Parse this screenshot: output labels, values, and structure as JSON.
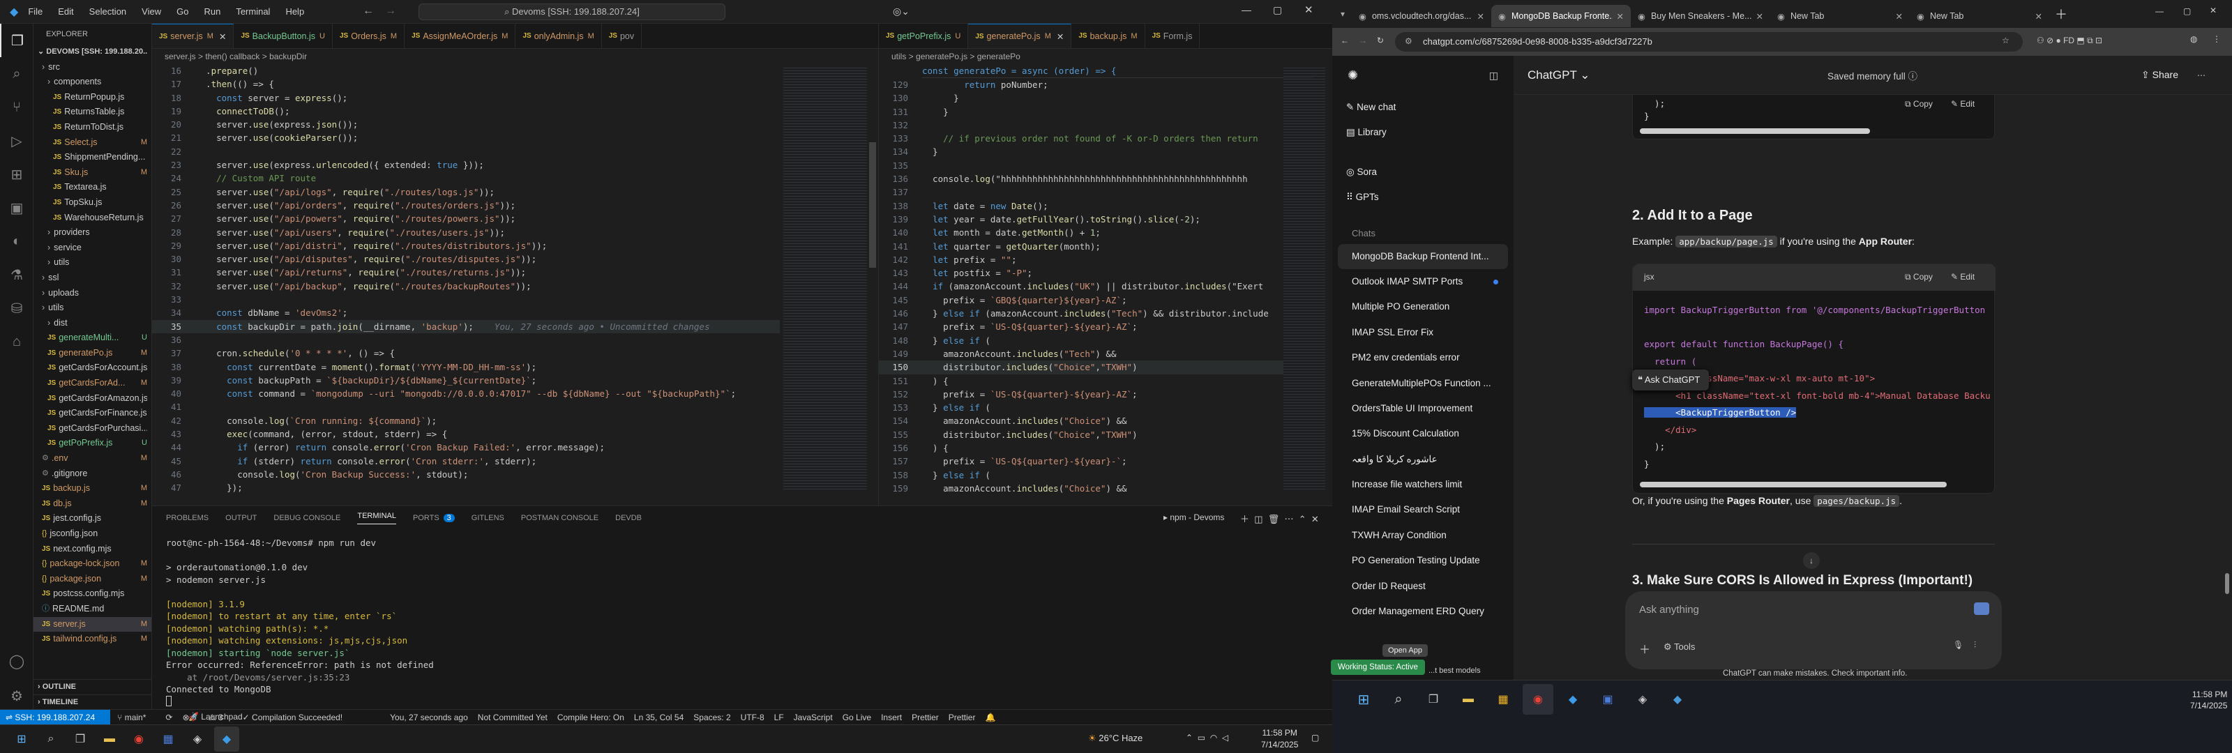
{
  "vscode": {
    "menu": [
      "File",
      "Edit",
      "Selection",
      "View",
      "Go",
      "Run",
      "Terminal",
      "Help"
    ],
    "search": "Devoms [SSH: 199.188.207.24]",
    "explorer": {
      "header": "EXPLORER",
      "root": "DEVOMS [SSH: 199.188.20...",
      "items": [
        {
          "label": "src",
          "kind": "folder",
          "indent": 1
        },
        {
          "label": "components",
          "kind": "folder",
          "indent": 2
        },
        {
          "label": "ReturnPopup.js",
          "kind": "js",
          "indent": 3,
          "status": ""
        },
        {
          "label": "ReturnsTable.js",
          "kind": "js",
          "indent": 3,
          "status": ""
        },
        {
          "label": "ReturnToDist.js",
          "kind": "js",
          "indent": 3,
          "status": ""
        },
        {
          "label": "Select.js",
          "kind": "js",
          "indent": 3,
          "status": "M"
        },
        {
          "label": "ShippmentPending...",
          "kind": "js",
          "indent": 3,
          "status": ""
        },
        {
          "label": "Sku.js",
          "kind": "js",
          "indent": 3,
          "status": "M"
        },
        {
          "label": "Textarea.js",
          "kind": "js",
          "indent": 3,
          "status": ""
        },
        {
          "label": "TopSku.js",
          "kind": "js",
          "indent": 3,
          "status": ""
        },
        {
          "label": "WarehouseReturn.js",
          "kind": "js",
          "indent": 3,
          "status": ""
        },
        {
          "label": "providers",
          "kind": "folder",
          "indent": 2
        },
        {
          "label": "service",
          "kind": "folder",
          "indent": 2
        },
        {
          "label": "utils",
          "kind": "folder",
          "indent": 2
        },
        {
          "label": "ssl",
          "kind": "folder",
          "indent": 1
        },
        {
          "label": "uploads",
          "kind": "folder",
          "indent": 1
        },
        {
          "label": "utils",
          "kind": "folder",
          "indent": 1
        },
        {
          "label": "dist",
          "kind": "folder",
          "indent": 2
        },
        {
          "label": "generateMulti...",
          "kind": "js",
          "indent": 2,
          "status": "U"
        },
        {
          "label": "generatePo.js",
          "kind": "js",
          "indent": 2,
          "status": "M"
        },
        {
          "label": "getCardsForAccount.js",
          "kind": "js",
          "indent": 2,
          "status": ""
        },
        {
          "label": "getCardsForAd...",
          "kind": "js",
          "indent": 2,
          "status": "M"
        },
        {
          "label": "getCardsForAmazon.js",
          "kind": "js",
          "indent": 2,
          "status": ""
        },
        {
          "label": "getCardsForFinance.js",
          "kind": "js",
          "indent": 2,
          "status": ""
        },
        {
          "label": "getCardsForPurchasi...",
          "kind": "js",
          "indent": 2,
          "status": ""
        },
        {
          "label": "getPoPrefix.js",
          "kind": "js",
          "indent": 2,
          "status": "U"
        },
        {
          "label": ".env",
          "kind": "file",
          "indent": 1,
          "status": "M"
        },
        {
          "label": ".gitignore",
          "kind": "file",
          "indent": 1,
          "status": ""
        },
        {
          "label": "backup.js",
          "kind": "js",
          "indent": 1,
          "status": "M"
        },
        {
          "label": "db.js",
          "kind": "js",
          "indent": 1,
          "status": "M"
        },
        {
          "label": "jest.config.js",
          "kind": "js",
          "indent": 1,
          "status": ""
        },
        {
          "label": "jsconfig.json",
          "kind": "json",
          "indent": 1,
          "status": ""
        },
        {
          "label": "next.config.mjs",
          "kind": "js",
          "indent": 1,
          "status": ""
        },
        {
          "label": "package-lock.json",
          "kind": "json",
          "indent": 1,
          "status": "M"
        },
        {
          "label": "package.json",
          "kind": "json",
          "indent": 1,
          "status": "M"
        },
        {
          "label": "postcss.config.mjs",
          "kind": "js",
          "indent": 1,
          "status": ""
        },
        {
          "label": "README.md",
          "kind": "md",
          "indent": 1,
          "status": ""
        },
        {
          "label": "server.js",
          "kind": "js",
          "indent": 1,
          "status": "M",
          "selected": true
        },
        {
          "label": "tailwind.config.js",
          "kind": "js",
          "indent": 1,
          "status": "M"
        }
      ],
      "outline": "OUTLINE",
      "timeline": "TIMELINE"
    },
    "left_tabs": [
      {
        "label": "server.js",
        "status": "M",
        "active": true
      },
      {
        "label": "BackupButton.js",
        "status": "U"
      },
      {
        "label": "Orders.js",
        "status": "M"
      },
      {
        "label": "AssignMeAOrder.js",
        "status": "M"
      },
      {
        "label": "onlyAdmin.js",
        "status": "M"
      },
      {
        "label": "pov",
        "status": ""
      }
    ],
    "left_breadcrumb": "server.js > then() callback > backupDir",
    "left_start_line": 16,
    "left_current_line": 35,
    "left_code": [
      "  .prepare()",
      "  .then(() => {",
      "    const server = express();",
      "    connectToDB();",
      "    server.use(express.json());",
      "    server.use(cookieParser());",
      "",
      "    server.use(express.urlencoded({ extended: true }));",
      "    // Custom API route",
      "    server.use(\"/api/logs\", require(\"./routes/logs.js\"));",
      "    server.use(\"/api/orders\", require(\"./routes/orders.js\"));",
      "    server.use(\"/api/powers\", require(\"./routes/powers.js\"));",
      "    server.use(\"/api/users\", require(\"./routes/users.js\"));",
      "    server.use(\"/api/distri\", require(\"./routes/distributors.js\"));",
      "    server.use(\"/api/disputes\", require(\"./routes/disputes.js\"));",
      "    server.use(\"/api/returns\", require(\"./routes/returns.js\"));",
      "    server.use(\"/api/backup\", require(\"./routes/backupRoutes\"));",
      "",
      "    const dbName = 'devOms2';",
      "    const backupDir = path.join(__dirname, 'backup');",
      "",
      "    cron.schedule('0 * * * *', () => {",
      "      const currentDate = moment().format('YYYY-MM-DD_HH-mm-ss');",
      "      const backupPath = `${backupDir}/${dbName}_${currentDate}`;",
      "      const command = `mongodump --uri \"mongodb://0.0.0.0:47017\" --db ${dbName} --out \"${backupPath}\"`;",
      "",
      "      console.log(`Cron running: ${command}`);",
      "      exec(command, (error, stdout, stderr) => {",
      "        if (error) return console.error('Cron Backup Failed:', error.message);",
      "        if (stderr) return console.error('Cron stderr:', stderr);",
      "        console.log('Cron Backup Success:', stdout);",
      "      });",
      "    });"
    ],
    "blame": "You, 27 seconds ago • Uncommitted changes",
    "right_tabs": [
      {
        "label": "getPoPrefix.js",
        "status": "U"
      },
      {
        "label": "generatePo.js",
        "status": "M",
        "active": true
      },
      {
        "label": "backup.js",
        "status": "M"
      },
      {
        "label": "Form.js",
        "status": ""
      }
    ],
    "right_breadcrumb": "utils > generatePo.js > generatePo",
    "right_header": "const generatePo = async (order) => {",
    "right_start_line": 129,
    "right_current_line": 150,
    "right_code": [
      "        return poNumber;",
      "      }",
      "    }",
      "",
      "    // if previous order not found of -K or-D orders then return",
      "  }",
      "",
      "  console.log(\"hhhhhhhhhhhhhhhhhhhhhhhhhhhhhhhhhhhhhhhhhhhhhhh",
      "",
      "  let date = new Date();",
      "  let year = date.getFullYear().toString().slice(-2);",
      "  let month = date.getMonth() + 1;",
      "  let quarter = getQuarter(month);",
      "  let prefix = \"\";",
      "  let postfix = \"-P\";",
      "  if (amazonAccount.includes(\"UK\") || distributor.includes(\"Exert",
      "    prefix = `GBQ${quarter}${year}-AZ`;",
      "  } else if (amazonAccount.includes(\"Tech\") && distributor.include",
      "    prefix = `US-Q${quarter}-${year}-AZ`;",
      "  } else if (",
      "    amazonAccount.includes(\"Tech\") &&",
      "    distributor.includes(\"Choice\",\"TXWH\")",
      "  ) {",
      "    prefix = `US-Q${quarter}-${year}-AZ`;",
      "  } else if (",
      "    amazonAccount.includes(\"Choice\") &&",
      "    distributor.includes(\"Choice\",\"TXWH\")",
      "  ) {",
      "    prefix = `US-Q${quarter}-${year}-`;",
      "  } else if (",
      "    amazonAccount.includes(\"Choice\") &&",
      "    distributor.includes(\"Tech\",\"TXWH\")"
    ],
    "panel_tabs": [
      "PROBLEMS",
      "OUTPUT",
      "DEBUG CONSOLE",
      "TERMINAL",
      "PORTS",
      "GITLENS",
      "POSTMAN CONSOLE",
      "DEVDB"
    ],
    "ports_badge": "3",
    "terminal_title": "npm - Devoms",
    "terminal_lines": [
      {
        "t": "root@nc-ph-1564-48:~/Devoms# npm run dev",
        "c": "#ccc"
      },
      {
        "t": "",
        "c": "#ccc"
      },
      {
        "t": "> orderautomation@0.1.0 dev",
        "c": "#ccc"
      },
      {
        "t": "> nodemon server.js",
        "c": "#ccc"
      },
      {
        "t": "",
        "c": "#ccc"
      },
      {
        "t": "[nodemon] 3.1.9",
        "c": "#d7ba3d"
      },
      {
        "t": "[nodemon] to restart at any time, enter `rs`",
        "c": "#d7ba3d"
      },
      {
        "t": "[nodemon] watching path(s): *.*",
        "c": "#d7ba3d"
      },
      {
        "t": "[nodemon] watching extensions: js,mjs,cjs,json",
        "c": "#d7ba3d"
      },
      {
        "t": "[nodemon] starting `node server.js`",
        "c": "#73c991"
      },
      {
        "t": "Error occurred: ReferenceError: path is not defined",
        "c": "#ccc"
      },
      {
        "t": "    at /root/Devoms/server.js:35:23",
        "c": "#999"
      },
      {
        "t": "Connected to MongoDB",
        "c": "#ccc"
      }
    ],
    "status": {
      "remote": "SSH: 199.188.207.24",
      "branch": "main*",
      "errors": "0",
      "warnings": "3",
      "compile": "Compilation Succeeded!",
      "blame": "You, 27 seconds ago",
      "commit": "Not Committed Yet",
      "hero": "Compile Hero: On",
      "pos": "Ln 35, Col 54",
      "spaces": "Spaces: 2",
      "enc": "UTF-8",
      "eol": "LF",
      "lang": "JavaScript",
      "golive": "Go Live",
      "insert": "Insert",
      "prettier": "Prettier",
      "prettier2": "Prettier"
    }
  },
  "taskbar": {
    "weather": "26°C  Haze",
    "time": "11:58 PM",
    "date": "7/14/2025",
    "launchpad": "Launchpad"
  },
  "chrome": {
    "tabs": [
      {
        "label": "oms.vcloudtech.org/das...",
        "active": false
      },
      {
        "label": "MongoDB Backup Fronte...",
        "active": true
      },
      {
        "label": "Buy Men Sneakers - Me...",
        "active": false
      },
      {
        "label": "New Tab",
        "active": false
      },
      {
        "label": "New Tab",
        "active": false
      }
    ],
    "url": "chatgpt.com/c/6875269d-0e98-8008-b335-a9dcf3d7227b"
  },
  "chatgpt": {
    "new_chat": "New chat",
    "library": "Library",
    "sora": "Sora",
    "gpts": "GPTs",
    "chats_label": "Chats",
    "chats": [
      "MongoDB Backup Frontend Int...",
      "Outlook IMAP SMTP Ports",
      "Multiple PO Generation",
      "IMAP SSL Error Fix",
      "PM2 env credentials error",
      "GenerateMultiplePOs Function ...",
      "OrdersTable UI Improvement",
      "15% Discount Calculation",
      "عاشوره کربلا کا واقعہ",
      "Increase file watchers limit",
      "IMAP Email Search Script",
      "TXWH Array Condition",
      "PO Generation Testing Update",
      "Order ID Request",
      "Order Management ERD Query"
    ],
    "model": "ChatGPT",
    "memory": "Saved memory full",
    "share": "Share",
    "copy": "Copy",
    "edit": "Edit",
    "code1_tail": [
      "  );",
      "}"
    ],
    "heading2": "2. Add It to a Page",
    "example_prefix": "Example:",
    "example_code": "app/backup/page.js",
    "example_mid": "if you're using the",
    "example_bold": "App Router",
    "lang_jsx": "jsx",
    "code2": [
      "import BackupTriggerButton from '@/components/BackupTriggerButton",
      "",
      "export default function BackupPage() {",
      "  return (",
      "    <div className=\"max-w-xl mx-auto mt-10\">",
      "      <h1 className=\"text-xl font-bold mb-4\">Manual Database Backu",
      "      <BackupTriggerButton />",
      "    </div>",
      "  );",
      "}"
    ],
    "ask_popup": "Ask ChatGPT",
    "or_text": "Or, if you're using the",
    "pages_router": "Pages Router",
    "use_text": ", use",
    "pages_code": "pages/backup.js",
    "heading3": "3. Make Sure CORS Is Allowed in Express (Important!)",
    "input_placeholder": "Ask anything",
    "tools": "Tools",
    "disclaimer": "ChatGPT can make mistakes. Check important info.",
    "open_app": "Open App",
    "working_status": "Working Status: Active",
    "best_models": "...t best models"
  },
  "win_taskbar": {
    "time": "11:58 PM",
    "date": "7/14/2025"
  }
}
